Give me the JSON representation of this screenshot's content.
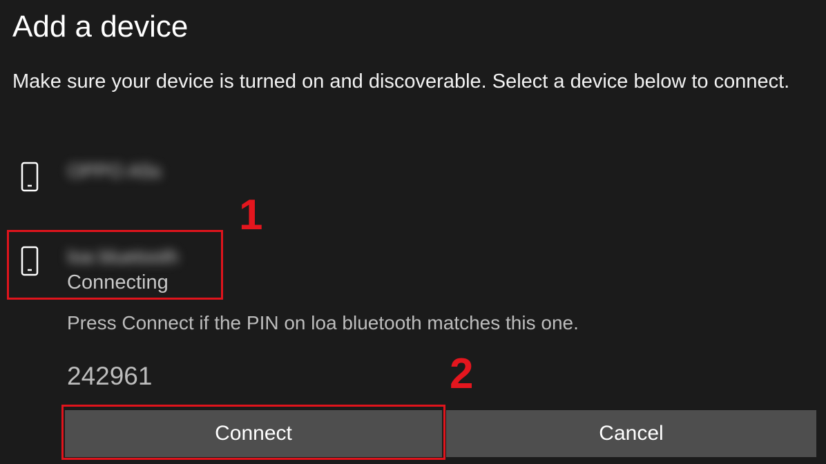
{
  "dialog": {
    "title": "Add a device",
    "subtitle": "Make sure your device is turned on and discoverable. Select a device below to connect."
  },
  "devices": [
    {
      "name": "OPPO A5s",
      "icon": "phone-icon",
      "status": ""
    },
    {
      "name": "loa bluetooth",
      "icon": "phone-icon",
      "status": "Connecting"
    }
  ],
  "pairing": {
    "hint": "Press Connect if the PIN on loa bluetooth matches this one.",
    "pin": "242961"
  },
  "buttons": {
    "connect": "Connect",
    "cancel": "Cancel"
  },
  "annotations": {
    "step1": "1",
    "step2": "2",
    "color": "#e0141c"
  },
  "colors": {
    "background": "#1b1b1b",
    "button": "#4e4e4e",
    "text": "#ffffff",
    "secondary_text": "#bdbdbd"
  }
}
